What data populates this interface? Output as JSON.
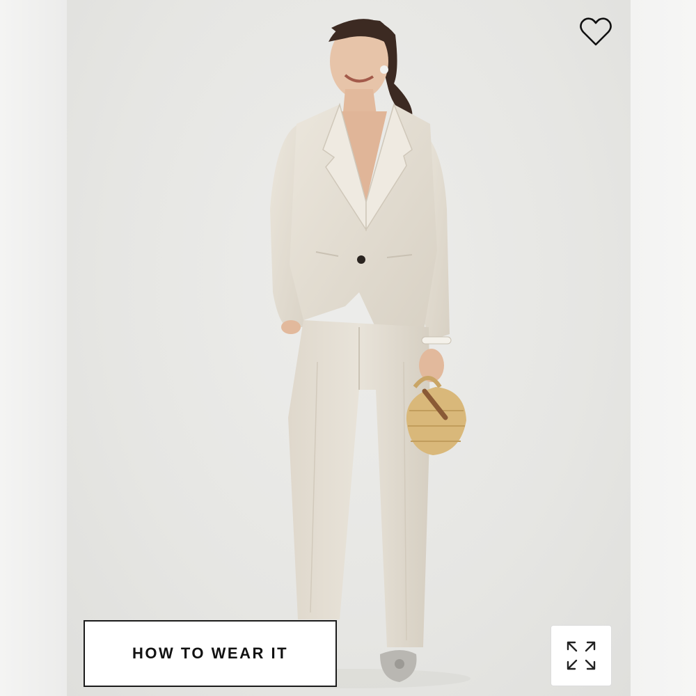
{
  "product_image": {
    "background_color": "#e8e8e5",
    "suit_color": "#e3ddd2",
    "bag_color": "#d9b87a"
  },
  "actions": {
    "favorite": {
      "icon": "heart-outline-icon"
    },
    "how_to_wear": {
      "label": "HOW TO WEAR IT"
    },
    "expand": {
      "icon": "expand-arrows-icon"
    }
  }
}
